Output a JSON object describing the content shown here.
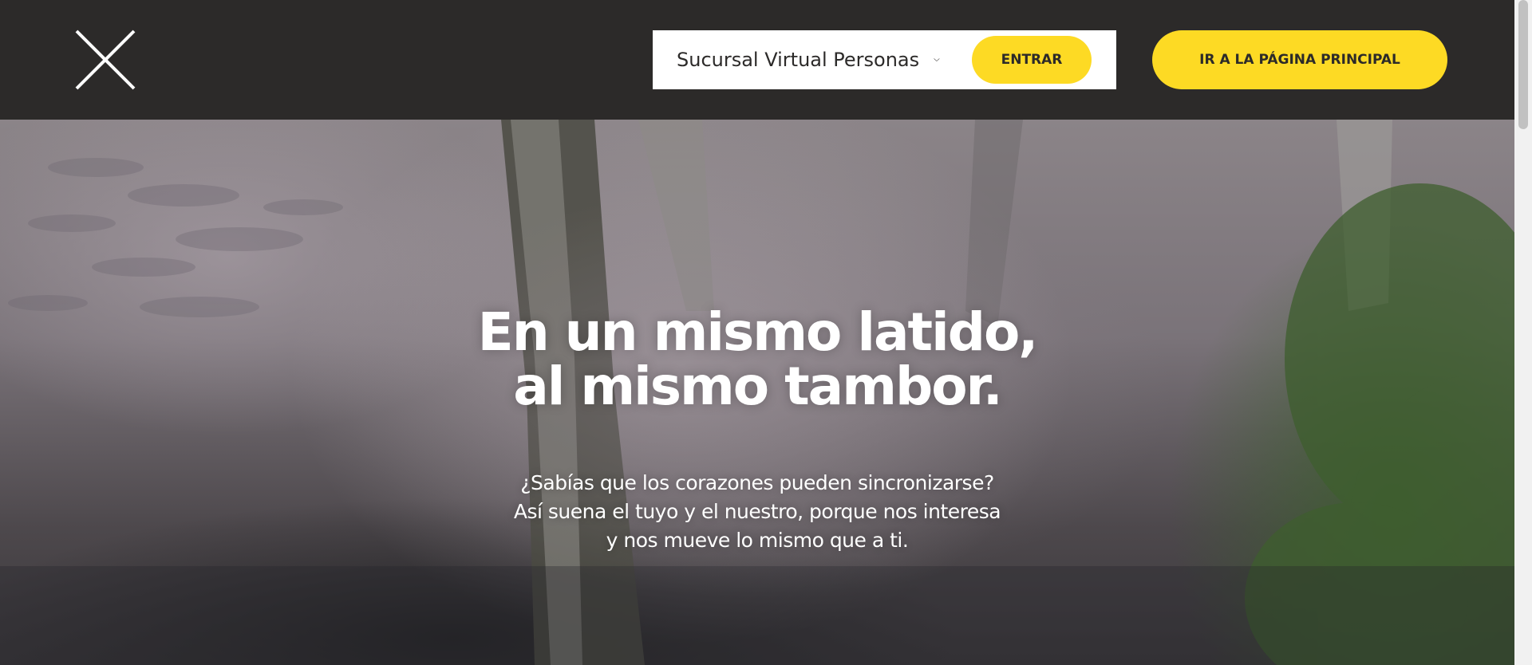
{
  "header": {
    "close_icon": "close-icon",
    "branch_selector": {
      "label": "Sucursal Virtual Personas",
      "icon": "chevron-down-icon"
    },
    "enter_label": "ENTRAR",
    "home_label": "IR A LA PÁGINA PRINCIPAL"
  },
  "hero": {
    "title_lines": [
      "En un mismo latido,",
      "al mismo tambor."
    ],
    "subtitle_lines": [
      "¿Sabías que los corazones pueden sincronizarse?",
      "Así suena el tuyo y el nuestro, porque nos interesa",
      "y nos mueve lo mismo que a ti."
    ]
  },
  "colors": {
    "header_bg": "#2c2a29",
    "accent_yellow": "#fdda24",
    "text_dark": "#2c2a29",
    "text_light": "#ffffff"
  }
}
